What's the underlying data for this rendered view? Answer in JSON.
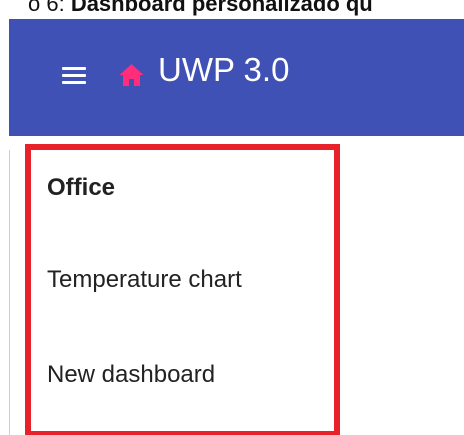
{
  "caption": {
    "prefix": "o 6: ",
    "highlight": "Dashboard personalizado qu"
  },
  "appbar": {
    "title": "UWP 3.0",
    "menu_icon": "hamburger-menu-icon",
    "home_icon": "home-icon",
    "bg_color": "#3f51b5",
    "home_icon_color": "#ff2d7a"
  },
  "menu": {
    "highlight_border_color": "#e8222a",
    "items": [
      {
        "label": "Office",
        "selected": true
      },
      {
        "label": "Temperature chart"
      },
      {
        "label": "New dashboard"
      }
    ]
  }
}
